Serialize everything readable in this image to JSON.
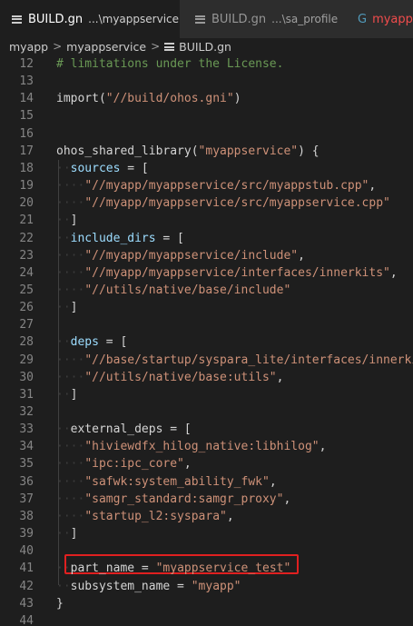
{
  "tabs": [
    {
      "label": "BUILD.gn",
      "desc": "...\\myappservice",
      "close": "✕",
      "active": true
    },
    {
      "label": "BUILD.gn",
      "desc": "...\\sa_profile",
      "active": false
    },
    {
      "label": "myapps",
      "desc": "",
      "active": false
    }
  ],
  "breadcrumb": {
    "items": [
      "myapp",
      "myappservice",
      "BUILD.gn"
    ],
    "separator": ">"
  },
  "editor": {
    "lines": [
      {
        "n": "12",
        "tokens": [
          {
            "t": "# limitations under the License.",
            "c": "c-comment"
          }
        ]
      },
      {
        "n": "13",
        "tokens": []
      },
      {
        "n": "14",
        "tokens": [
          {
            "t": "import(",
            "c": "c-punct"
          },
          {
            "t": "\"//build/ohos.gni\"",
            "c": "c-str"
          },
          {
            "t": ")",
            "c": "c-punct"
          }
        ]
      },
      {
        "n": "15",
        "tokens": []
      },
      {
        "n": "16",
        "tokens": []
      },
      {
        "n": "17",
        "tokens": [
          {
            "t": "ohos_shared_library(",
            "c": "c-punct"
          },
          {
            "t": "\"myappservice\"",
            "c": "c-str"
          },
          {
            "t": ") {",
            "c": "c-punct"
          }
        ]
      },
      {
        "n": "18",
        "tokens": [
          {
            "t": "  ",
            "c": "ws"
          },
          {
            "t": "sources",
            "c": "c-prop"
          },
          {
            "t": " = [",
            "c": "c-punct"
          }
        ]
      },
      {
        "n": "19",
        "tokens": [
          {
            "t": "    ",
            "c": "ws"
          },
          {
            "t": "\"//myapp/myappservice/src/myappstub.cpp\"",
            "c": "c-str"
          },
          {
            "t": ",",
            "c": "c-punct"
          }
        ]
      },
      {
        "n": "20",
        "tokens": [
          {
            "t": "    ",
            "c": "ws"
          },
          {
            "t": "\"//myapp/myappservice/src/myappservice.cpp\"",
            "c": "c-str"
          }
        ]
      },
      {
        "n": "21",
        "tokens": [
          {
            "t": "  ",
            "c": "ws"
          },
          {
            "t": "]",
            "c": "c-punct"
          }
        ]
      },
      {
        "n": "22",
        "tokens": [
          {
            "t": "  ",
            "c": "ws"
          },
          {
            "t": "include_dirs",
            "c": "c-prop"
          },
          {
            "t": " = [",
            "c": "c-punct"
          }
        ]
      },
      {
        "n": "23",
        "tokens": [
          {
            "t": "    ",
            "c": "ws"
          },
          {
            "t": "\"//myapp/myappservice/include\"",
            "c": "c-str"
          },
          {
            "t": ",",
            "c": "c-punct"
          }
        ]
      },
      {
        "n": "24",
        "tokens": [
          {
            "t": "    ",
            "c": "ws"
          },
          {
            "t": "\"//myapp/myappservice/interfaces/innerkits\"",
            "c": "c-str"
          },
          {
            "t": ",",
            "c": "c-punct"
          }
        ]
      },
      {
        "n": "25",
        "tokens": [
          {
            "t": "    ",
            "c": "ws"
          },
          {
            "t": "\"//utils/native/base/include\"",
            "c": "c-str"
          }
        ]
      },
      {
        "n": "26",
        "tokens": [
          {
            "t": "  ",
            "c": "ws"
          },
          {
            "t": "]",
            "c": "c-punct"
          }
        ]
      },
      {
        "n": "27",
        "tokens": []
      },
      {
        "n": "28",
        "tokens": [
          {
            "t": "  ",
            "c": "ws"
          },
          {
            "t": "deps",
            "c": "c-prop"
          },
          {
            "t": " = [",
            "c": "c-punct"
          }
        ]
      },
      {
        "n": "29",
        "tokens": [
          {
            "t": "    ",
            "c": "ws"
          },
          {
            "t": "\"//base/startup/syspara_lite/interfaces/innerki",
            "c": "c-str"
          }
        ]
      },
      {
        "n": "30",
        "tokens": [
          {
            "t": "    ",
            "c": "ws"
          },
          {
            "t": "\"//utils/native/base:utils\"",
            "c": "c-str"
          },
          {
            "t": ",",
            "c": "c-punct"
          }
        ]
      },
      {
        "n": "31",
        "tokens": [
          {
            "t": "  ",
            "c": "ws"
          },
          {
            "t": "]",
            "c": "c-punct"
          }
        ]
      },
      {
        "n": "32",
        "tokens": []
      },
      {
        "n": "33",
        "tokens": [
          {
            "t": "  ",
            "c": "ws"
          },
          {
            "t": "external_deps",
            "c": "c-punct"
          },
          {
            "t": " = [",
            "c": "c-punct"
          }
        ]
      },
      {
        "n": "34",
        "tokens": [
          {
            "t": "    ",
            "c": "ws"
          },
          {
            "t": "\"hiviewdfx_hilog_native:libhilog\"",
            "c": "c-str"
          },
          {
            "t": ",",
            "c": "c-punct"
          }
        ]
      },
      {
        "n": "35",
        "tokens": [
          {
            "t": "    ",
            "c": "ws"
          },
          {
            "t": "\"ipc:ipc_core\"",
            "c": "c-str"
          },
          {
            "t": ",",
            "c": "c-punct"
          }
        ]
      },
      {
        "n": "36",
        "tokens": [
          {
            "t": "    ",
            "c": "ws"
          },
          {
            "t": "\"safwk:system_ability_fwk\"",
            "c": "c-str"
          },
          {
            "t": ",",
            "c": "c-punct"
          }
        ]
      },
      {
        "n": "37",
        "tokens": [
          {
            "t": "    ",
            "c": "ws"
          },
          {
            "t": "\"samgr_standard:samgr_proxy\"",
            "c": "c-str"
          },
          {
            "t": ",",
            "c": "c-punct"
          }
        ]
      },
      {
        "n": "38",
        "tokens": [
          {
            "t": "    ",
            "c": "ws"
          },
          {
            "t": "\"startup_l2:syspara\"",
            "c": "c-str"
          },
          {
            "t": ",",
            "c": "c-punct"
          }
        ]
      },
      {
        "n": "39",
        "tokens": [
          {
            "t": "  ",
            "c": "ws"
          },
          {
            "t": "]",
            "c": "c-punct"
          }
        ]
      },
      {
        "n": "40",
        "tokens": []
      },
      {
        "n": "41",
        "tokens": [
          {
            "t": "  ",
            "c": "ws"
          },
          {
            "t": "part_name",
            "c": "c-punct"
          },
          {
            "t": " = ",
            "c": "c-punct"
          },
          {
            "t": "\"myappservice_test\"",
            "c": "c-str"
          }
        ]
      },
      {
        "n": "42",
        "tokens": [
          {
            "t": "  ",
            "c": "ws"
          },
          {
            "t": "subsystem_name",
            "c": "c-punct"
          },
          {
            "t": " = ",
            "c": "c-punct"
          },
          {
            "t": "\"myapp\"",
            "c": "c-str"
          }
        ]
      },
      {
        "n": "43",
        "tokens": [
          {
            "t": "}",
            "c": "c-punct"
          }
        ]
      },
      {
        "n": "44",
        "tokens": []
      }
    ]
  },
  "colors": {
    "highlight_border": "#e02020",
    "string": "#ce9178",
    "comment": "#6a9955",
    "property": "#9cdcfe"
  }
}
